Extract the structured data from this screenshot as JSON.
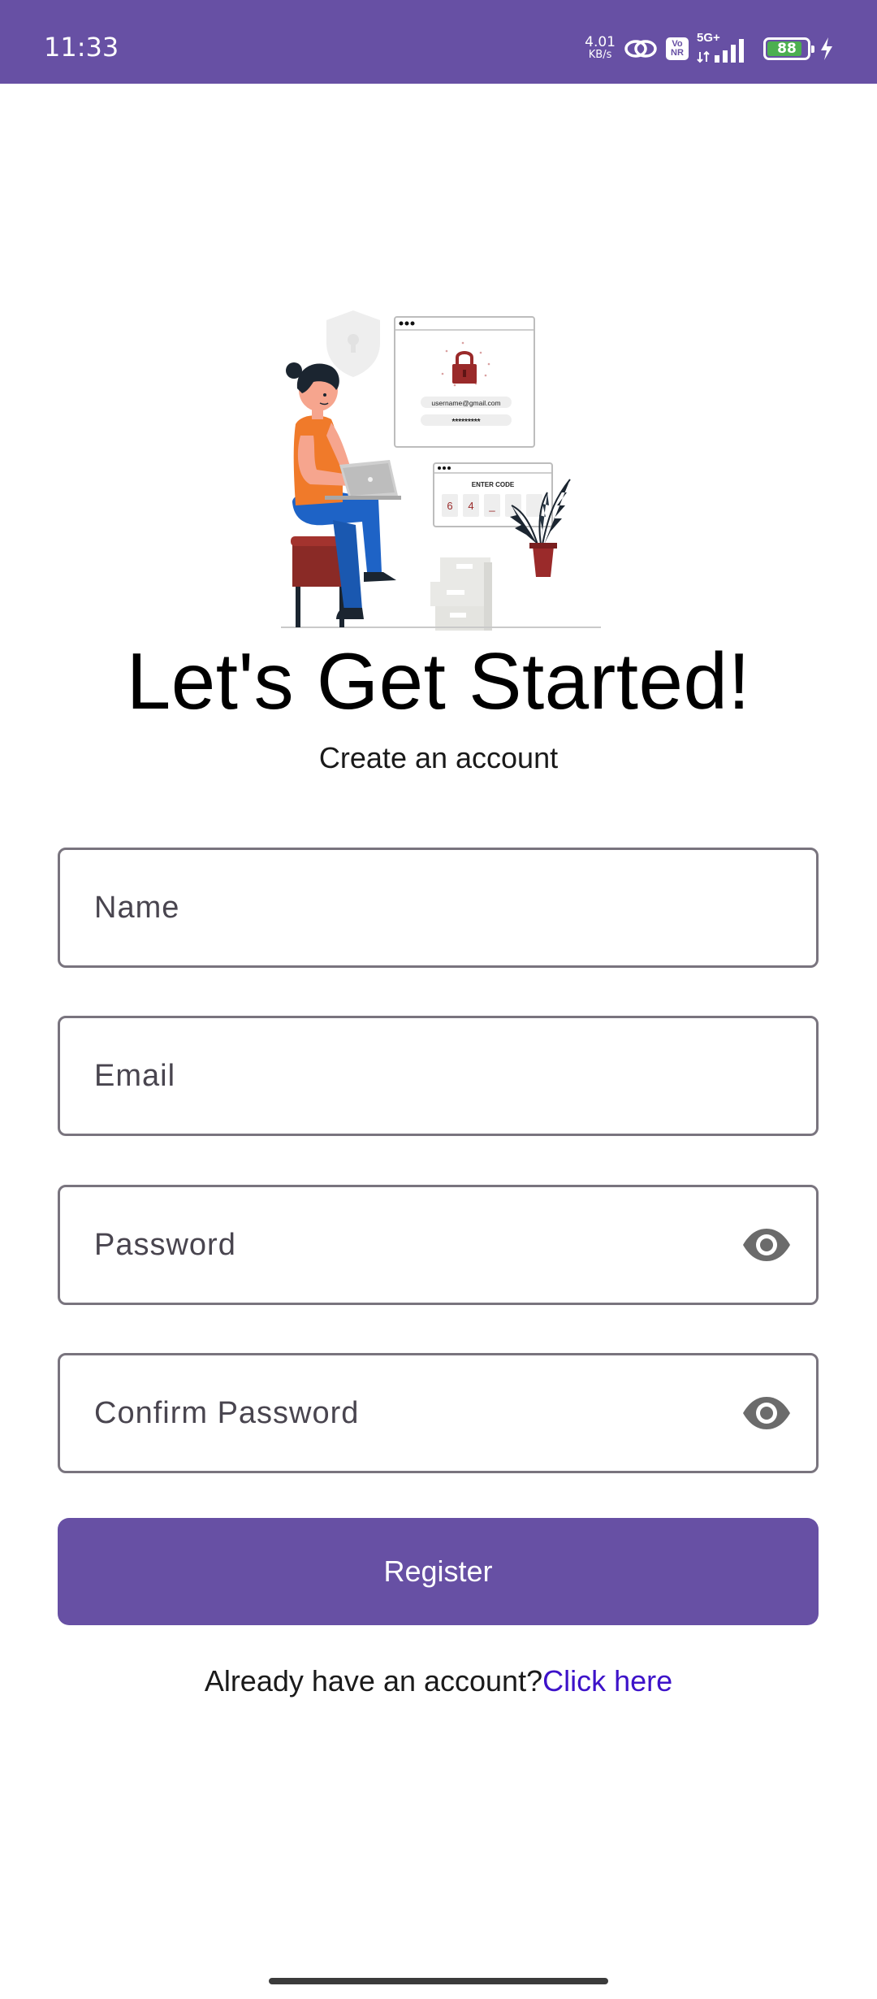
{
  "status_bar": {
    "time": "11:33",
    "net_speed_value": "4.01",
    "net_speed_unit": "KB/s",
    "volte_top": "Vo",
    "volte_bottom": "NR",
    "network_type": "5G+",
    "battery_level": "88",
    "battery_fraction": 0.88,
    "background_color": "#6750a4"
  },
  "illustration": {
    "login_card_email": "username@gmail.com",
    "login_card_password": "*********",
    "code_card_title": "ENTER CODE",
    "code_digits": [
      "6",
      "4",
      "_",
      "",
      ""
    ]
  },
  "header": {
    "title": "Let's Get Started!",
    "subtitle": "Create an account"
  },
  "form": {
    "name_placeholder": "Name",
    "email_placeholder": "Email",
    "password_placeholder": "Password",
    "confirm_password_placeholder": "Confirm Password",
    "visibility_icon": "eye-icon",
    "register_label": "Register"
  },
  "footer": {
    "login_prompt": "Already have an account?",
    "login_link": "Click here"
  },
  "colors": {
    "primary": "#6750a4",
    "link": "#3d12c9",
    "field_border": "#79747e"
  }
}
